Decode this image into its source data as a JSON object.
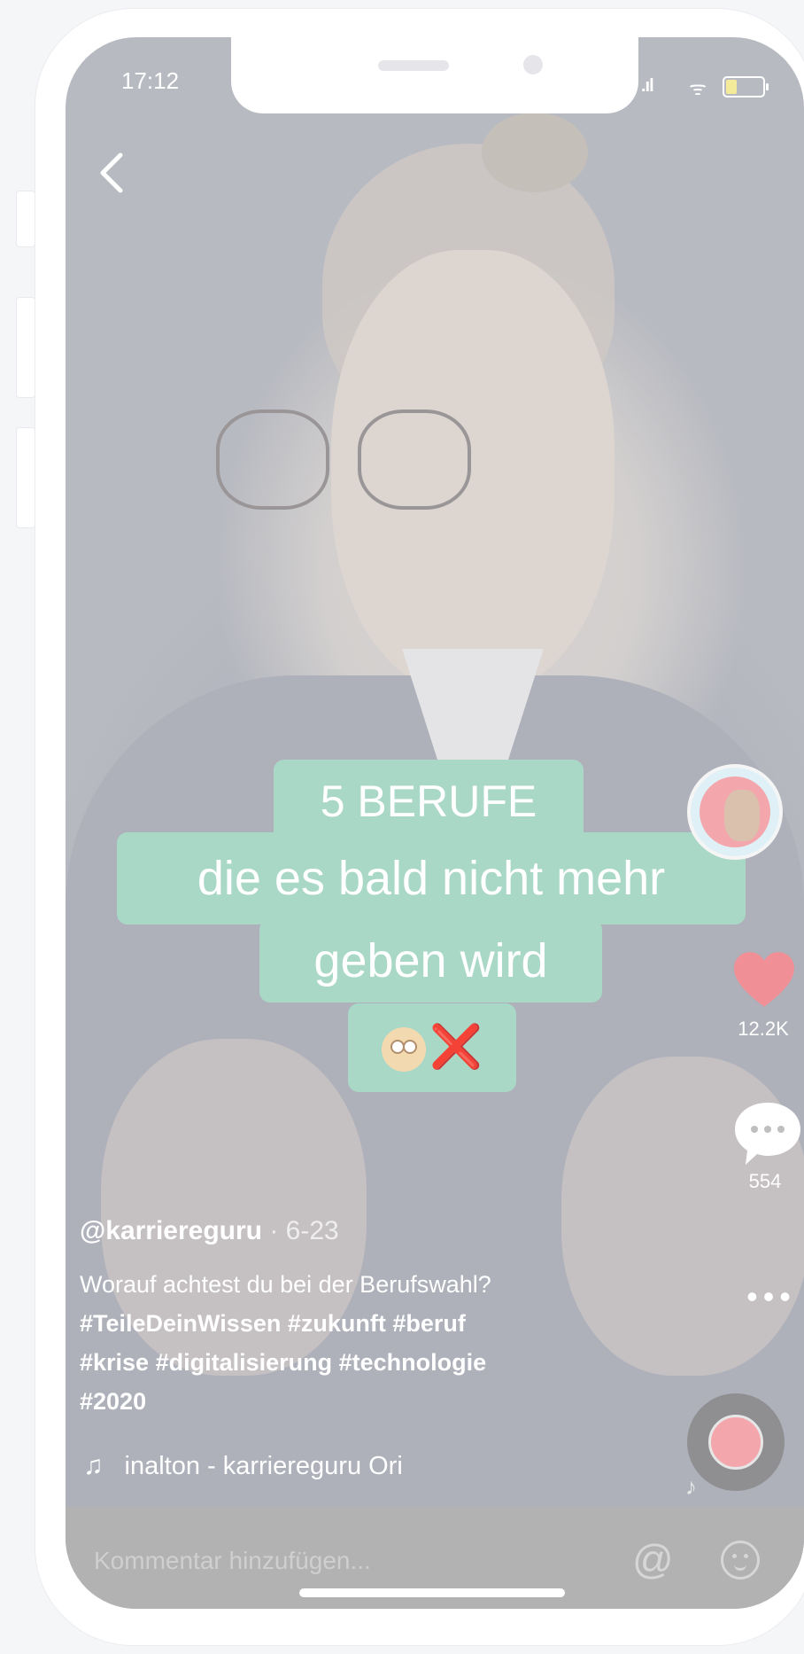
{
  "status_bar": {
    "time": "17:12",
    "battery_level": 0.3
  },
  "video": {
    "caption_lines": [
      "5 BERUFE",
      "die es bald nicht mehr",
      "geben wird"
    ],
    "caption_emoji": [
      "flushed-face",
      "cross-mark"
    ],
    "caption_x": "❌"
  },
  "actions": {
    "likes": "12.2K",
    "comments": "554",
    "more": "•••"
  },
  "post": {
    "author": "@karriereguru",
    "date": " · 6-23",
    "text": "Worauf achtest du bei der Berufswahl?",
    "hashtags_line1": "#TeileDeinWissen #zukunft #beruf",
    "hashtags_line2": "#krise #digitalisierung #technologie",
    "hashtags_line3": "#2020",
    "music": "inalton - karriereguru   Ori"
  },
  "comment_bar": {
    "placeholder": "Kommentar hinzufügen...",
    "at_symbol": "@"
  },
  "icons": [
    "back-icon",
    "heart-icon",
    "comment-icon",
    "more-icon",
    "music-note-icon",
    "at-icon",
    "emoji-icon"
  ],
  "colors": {
    "caption_bg": "#a9d8c7",
    "heart": "#f08f95",
    "bottom_bar": "#b2b2b2"
  }
}
